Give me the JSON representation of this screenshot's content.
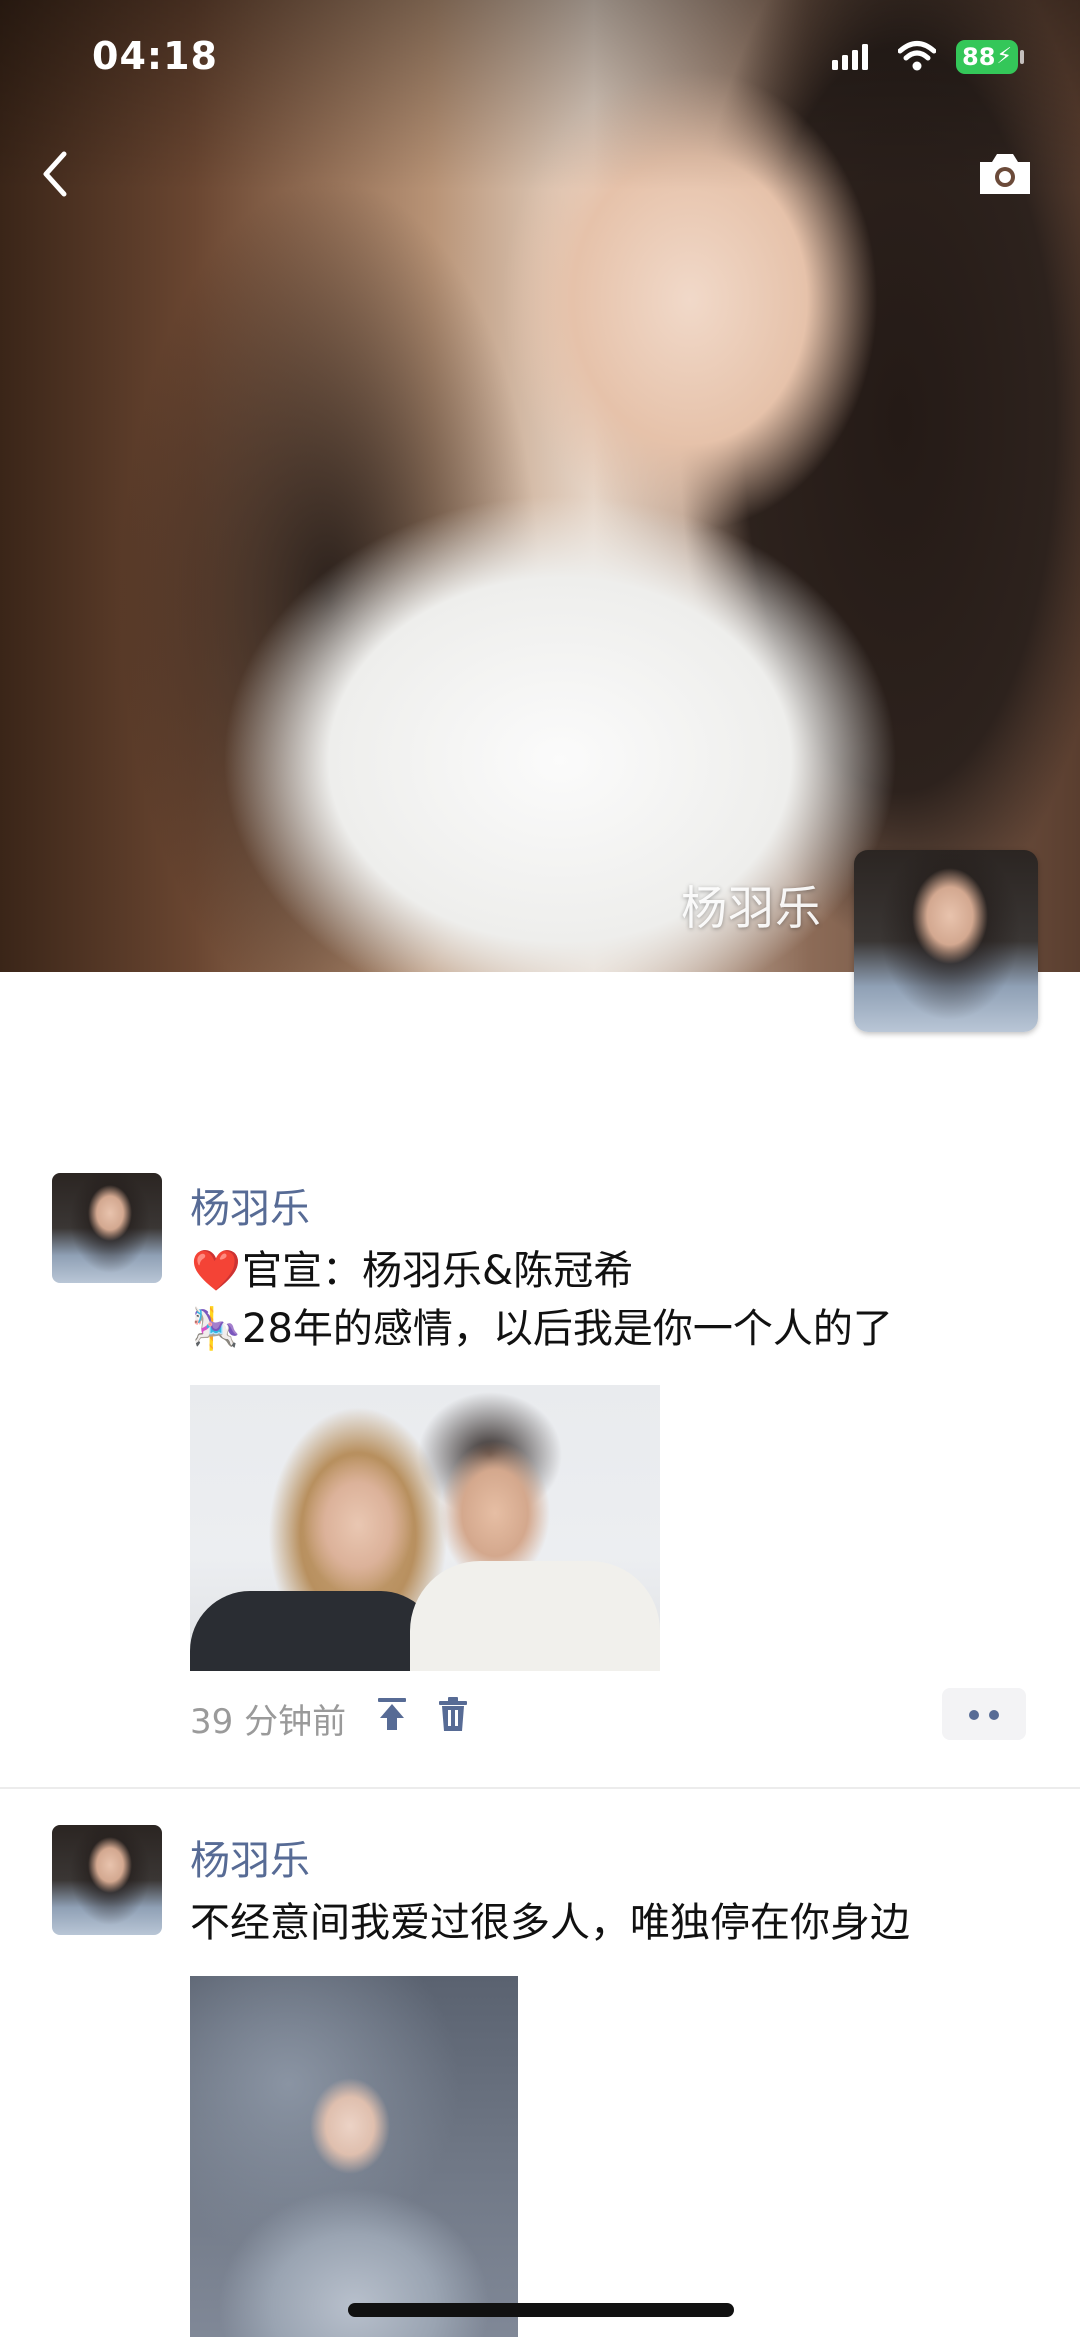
{
  "status_bar": {
    "time": "04:18",
    "battery": "88",
    "signal_icon": "cellular-signal-icon",
    "wifi_icon": "wifi-icon",
    "battery_icon": "battery-charging-icon"
  },
  "nav": {
    "back_icon": "chevron-left-icon",
    "camera_icon": "camera-icon"
  },
  "cover": {
    "name": "杨羽乐"
  },
  "posts": [
    {
      "author": "杨羽乐",
      "lines": [
        {
          "emoji": "❤️",
          "text": "官宣：杨羽乐&陈冠希"
        },
        {
          "emoji": "🎠",
          "text": "28年的感情，以后我是你一个人的了"
        }
      ],
      "time": "39 分钟前"
    },
    {
      "author": "杨羽乐",
      "lines": [
        {
          "text": "不经意间我爱过很多人，唯独停在你身边"
        }
      ]
    }
  ],
  "colors": {
    "author_link": "#576b95",
    "battery_green": "#34c759",
    "meta_gray": "#9a9a9a"
  }
}
